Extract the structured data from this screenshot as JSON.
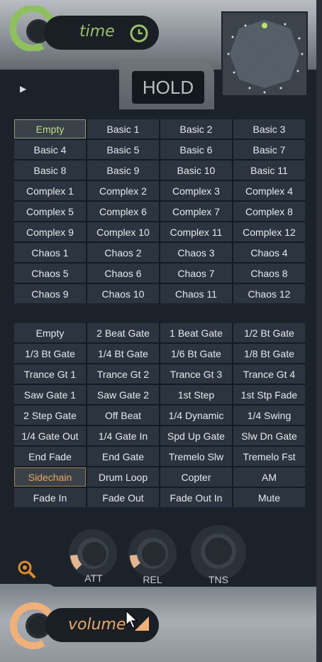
{
  "header": {
    "time_label": "time",
    "hold_label": "HOLD"
  },
  "presets_top": [
    [
      "Empty",
      "Basic 1",
      "Basic 2",
      "Basic 3"
    ],
    [
      "Basic 4",
      "Basic 5",
      "Basic 6",
      "Basic 7"
    ],
    [
      "Basic 8",
      "Basic 9",
      "Basic 10",
      "Basic 11"
    ],
    [
      "Complex 1",
      "Complex 2",
      "Complex 3",
      "Complex 4"
    ],
    [
      "Complex 5",
      "Complex 6",
      "Complex 7",
      "Complex 8"
    ],
    [
      "Complex 9",
      "Complex 10",
      "Complex 11",
      "Complex 12"
    ],
    [
      "Chaos 1",
      "Chaos 2",
      "Chaos 3",
      "Chaos 4"
    ],
    [
      "Chaos 5",
      "Chaos 6",
      "Chaos 7",
      "Chaos 8"
    ],
    [
      "Chaos 9",
      "Chaos 10",
      "Chaos 11",
      "Chaos 12"
    ]
  ],
  "presets_bottom": [
    [
      "Empty",
      "2 Beat Gate",
      "1 Beat Gate",
      "1/2 Bt Gate"
    ],
    [
      "1/3 Bt Gate",
      "1/4 Bt Gate",
      "1/6 Bt Gate",
      "1/8 Bt Gate"
    ],
    [
      "Trance Gt 1",
      "Trance Gt 2",
      "Trance Gt 3",
      "Trance Gt 4"
    ],
    [
      "Saw Gate 1",
      "Saw Gate 2",
      "1st Step",
      "1st Stp Fade"
    ],
    [
      "2 Step Gate",
      "Off Beat",
      "1/4 Dynamic",
      "1/4 Swing"
    ],
    [
      "1/4 Gate Out",
      "1/4 Gate In",
      "Spd Up Gate",
      "Slw Dn Gate"
    ],
    [
      "End Fade",
      "End Gate",
      "Tremelo Slw",
      "Tremelo Fst"
    ],
    [
      "Sidechain",
      "Drum Loop",
      "Copter",
      "AM"
    ],
    [
      "Fade In",
      "Fade Out",
      "Fade Out In",
      "Mute"
    ]
  ],
  "selected_top": "Empty",
  "selected_bottom": "Sidechain",
  "knobs": {
    "att_label": "ATT",
    "rel_label": "REL",
    "tns_label": "TNS"
  },
  "footer": {
    "volume_label": "volume"
  },
  "colors": {
    "time_accent": "#9ac06a",
    "volume_accent": "#e6a86a",
    "cell_bg": "#2c353f",
    "panel_bg": "#1c2229"
  }
}
